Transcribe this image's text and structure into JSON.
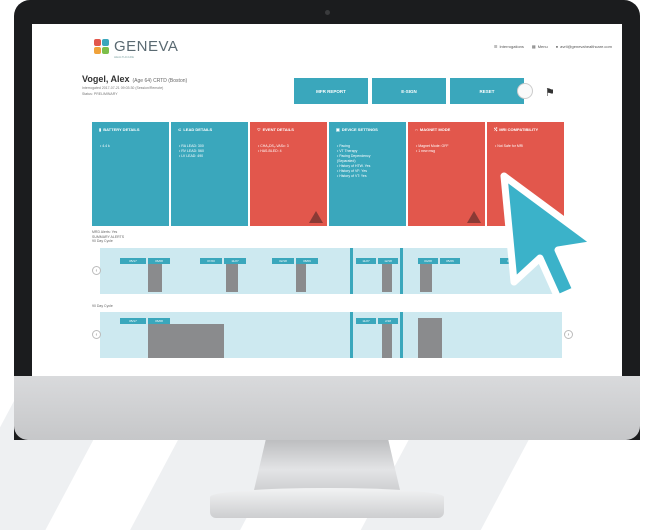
{
  "app": {
    "logo_text": "GENEVA",
    "logo_sub": "HEALTHCARE",
    "nav": [
      {
        "label": "Interrogations",
        "icon": "list-icon"
      },
      {
        "label": "Menu",
        "icon": "grid-icon"
      },
      {
        "label": "avril@genevahealthcare.com",
        "icon": "user-icon"
      }
    ]
  },
  "patient": {
    "name": "Vogel, Alex",
    "meta": "(Age 64)  CRTD (Boston)",
    "line1": "Interrogated 2017-07-21 09:03:30 (Session/Remote)",
    "line2": "Status: PRELIMINARY"
  },
  "actions": {
    "report": "MFR REPORT",
    "esign": "E-SIGN",
    "reset": "RESET"
  },
  "cards": [
    {
      "title": "BATTERY DETAILS",
      "icon": "battery-icon",
      "color": "teal",
      "lines": [
        "• 4.4 k"
      ],
      "warn": false
    },
    {
      "title": "LEAD DETAILS",
      "icon": "lead-icon",
      "color": "teal",
      "lines": [
        "• RA LEAD: 300",
        "• RV LEAD: 560",
        "• LV LEAD: 490"
      ],
      "warn": false
    },
    {
      "title": "EVENT DETAILS",
      "icon": "heart-icon",
      "color": "red",
      "lines": [
        "• CHA₂DS₂-VASc: 3",
        "• HAS-BLED: 4"
      ],
      "warn": true
    },
    {
      "title": "DEVICE SETTINGS",
      "icon": "settings-icon",
      "color": "teal",
      "lines": [
        "• Pacing",
        "• VT Therapy",
        "• Pacing Dependency",
        "  (Separated)",
        "• History of HTW. Yes",
        "• History of VF: Yes",
        "• History of VT: Yes"
      ],
      "warn": false
    },
    {
      "title": "MAGNET MODE",
      "icon": "magnet-icon",
      "color": "red",
      "lines": [
        "• Magnet Mode: OFF",
        "• 1 new msg"
      ],
      "warn": true
    },
    {
      "title": "MRI COMPATIBILITY",
      "icon": "mri-icon",
      "color": "red",
      "lines": [
        "• Not Safe for MRI"
      ],
      "warn": false
    }
  ],
  "timelines": {
    "label1": [
      "MRD Alerts: Yes",
      "SUMMARY ALERTS",
      "90 Day Cycle"
    ],
    "label2": [
      "90 Day Cycle"
    ],
    "tags1": [
      "05/17",
      "06/08",
      "07/20",
      "11/27",
      "02/18",
      "08/09",
      "11/27",
      "12/18",
      "04/28",
      "05/26",
      "07/17"
    ],
    "tags2": [
      "05/17",
      "06/08",
      "11/27",
      "2/18"
    ]
  },
  "colors": {
    "teal": "#3aa7bc",
    "red": "#e2574c",
    "cursor": "#3bb2c9"
  }
}
